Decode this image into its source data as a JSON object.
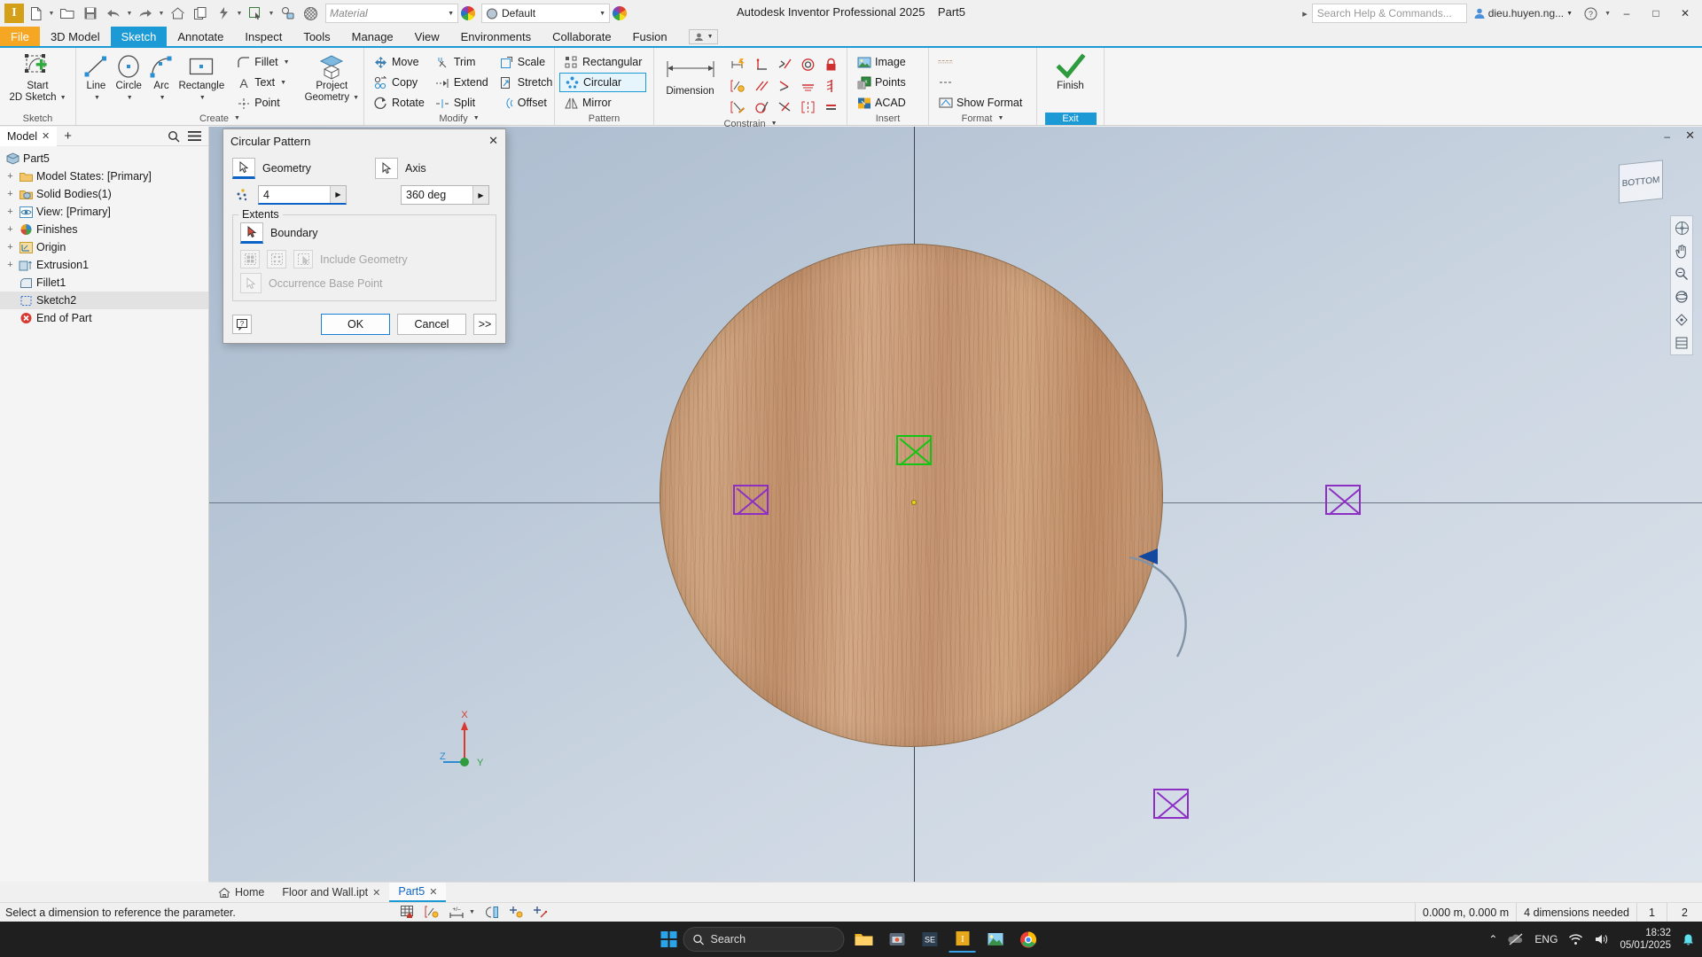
{
  "window": {
    "app_title": "Autodesk Inventor Professional 2025",
    "document_title": "Part5",
    "minimize": "–",
    "maximize": "□",
    "close": "✕"
  },
  "qat": {
    "logo": "I",
    "items": [
      {
        "name": "new-file-icon",
        "glyph": "new"
      },
      {
        "name": "open-file-icon",
        "glyph": "open"
      },
      {
        "name": "save-icon",
        "glyph": "save"
      },
      {
        "name": "undo-icon",
        "glyph": "undo"
      },
      {
        "name": "redo-icon",
        "glyph": "redo"
      },
      {
        "name": "home-icon",
        "glyph": "home"
      },
      {
        "name": "copy-icon",
        "glyph": "copy"
      },
      {
        "name": "update-icon",
        "glyph": "update"
      },
      {
        "name": "select-icon",
        "glyph": "select"
      },
      {
        "name": "measure-icon",
        "glyph": "measure"
      },
      {
        "name": "material-sphere-icon",
        "glyph": "sphere"
      }
    ],
    "material_value": "Material",
    "appearance_value": "Default"
  },
  "search": {
    "help_placeholder": "Search Help & Commands..."
  },
  "account": {
    "user": "dieu.huyen.ng...",
    "caret": "▾",
    "help": "?"
  },
  "menu": {
    "tabs": [
      {
        "label": "File",
        "state": "file"
      },
      {
        "label": "3D Model",
        "state": "normal"
      },
      {
        "label": "Sketch",
        "state": "active"
      },
      {
        "label": "Annotate",
        "state": "normal"
      },
      {
        "label": "Inspect",
        "state": "normal"
      },
      {
        "label": "Tools",
        "state": "normal"
      },
      {
        "label": "Manage",
        "state": "normal"
      },
      {
        "label": "View",
        "state": "normal"
      },
      {
        "label": "Environments",
        "state": "normal"
      },
      {
        "label": "Collaborate",
        "state": "normal"
      },
      {
        "label": "Fusion",
        "state": "normal"
      }
    ]
  },
  "ribbon": {
    "panels": [
      {
        "title": "Sketch",
        "big": {
          "line1": "Start",
          "line2": "2D Sketch",
          "icon": "start-2d-sketch-icon"
        }
      },
      {
        "title": "Create",
        "big_items": [
          {
            "label": "Line",
            "icon": "line-icon"
          },
          {
            "label": "Circle",
            "icon": "circle-icon"
          },
          {
            "label": "Arc",
            "icon": "arc-icon"
          },
          {
            "label": "Rectangle",
            "icon": "rectangle-icon"
          }
        ],
        "small_items": [
          {
            "label": "Fillet",
            "icon": "fillet-icon",
            "caret": true
          },
          {
            "label": "Text",
            "icon": "text-icon",
            "caret": true
          },
          {
            "label": "Point",
            "icon": "point-icon",
            "caret": false
          }
        ],
        "project": {
          "line1": "Project",
          "line2": "Geometry",
          "icon": "project-geometry-icon"
        }
      },
      {
        "title": "Modify",
        "columns": [
          [
            {
              "label": "Move",
              "icon": "move-icon"
            },
            {
              "label": "Copy",
              "icon": "copy-icon"
            },
            {
              "label": "Rotate",
              "icon": "rotate-icon"
            }
          ],
          [
            {
              "label": "Trim",
              "icon": "trim-icon"
            },
            {
              "label": "Extend",
              "icon": "extend-icon"
            },
            {
              "label": "Split",
              "icon": "split-icon"
            }
          ],
          [
            {
              "label": "Scale",
              "icon": "scale-icon"
            },
            {
              "label": "Stretch",
              "icon": "stretch-icon"
            },
            {
              "label": "Offset",
              "icon": "offset-icon"
            }
          ]
        ]
      },
      {
        "title": "Pattern",
        "items": [
          {
            "label": "Rectangular",
            "icon": "rectangular-pattern-icon",
            "selected": false
          },
          {
            "label": "Circular",
            "icon": "circular-pattern-icon",
            "selected": true
          },
          {
            "label": "Mirror",
            "icon": "mirror-icon",
            "selected": false
          }
        ]
      },
      {
        "title": "Constrain",
        "dimension_label": "Dimension",
        "constraint_icons": [
          "auto-dimension-icon",
          "perpendicular-constraint-icon",
          "tangent-constraint-icon",
          "concentric-constraint-icon",
          "fix-constraint-icon",
          "show-constraints-icon",
          "parallel-constraint-icon",
          "coincident-constraint-icon",
          "horizontal-constraint-icon",
          "vertical-constraint-icon",
          "auto-constraint-icon",
          "smooth-constraint-icon",
          "collinear-constraint-icon",
          "symmetric-constraint-icon",
          "equal-constraint-icon"
        ]
      },
      {
        "title": "Insert",
        "items": [
          {
            "label": "Image",
            "icon": "image-icon"
          },
          {
            "label": "Points",
            "icon": "points-import-icon"
          },
          {
            "label": "ACAD",
            "icon": "acad-import-icon"
          }
        ]
      },
      {
        "title": "Format",
        "items": [
          {
            "label": "",
            "icon": "linetype-icon"
          },
          {
            "label": "",
            "icon": "construction-icon"
          },
          {
            "label": "Show Format",
            "icon": "show-format-icon"
          }
        ]
      },
      {
        "title": "Exit",
        "finish_label": "Finish",
        "exit_label": "Exit",
        "icon": "finish-sketch-check-icon"
      }
    ]
  },
  "browser": {
    "tab_label": "Model",
    "tab_close": "✕",
    "add": "+",
    "search_icon": "search-icon",
    "menu_icon": "hamburger-menu-icon",
    "tree": [
      {
        "label": "Part5",
        "expander": "",
        "icon": "part-icon",
        "indent": 0,
        "selected": false
      },
      {
        "label": "Model States: [Primary]",
        "expander": "+",
        "icon": "folder-icon",
        "indent": 1,
        "selected": false
      },
      {
        "label": "Solid Bodies(1)",
        "expander": "+",
        "icon": "solid-bodies-icon",
        "indent": 1,
        "selected": false
      },
      {
        "label": "View: [Primary]",
        "expander": "+",
        "icon": "view-icon",
        "indent": 1,
        "selected": false
      },
      {
        "label": "Finishes",
        "expander": "+",
        "icon": "finishes-icon",
        "indent": 1,
        "selected": false
      },
      {
        "label": "Origin",
        "expander": "+",
        "icon": "origin-icon",
        "indent": 1,
        "selected": false
      },
      {
        "label": "Extrusion1",
        "expander": "+",
        "icon": "extrusion-icon",
        "indent": 1,
        "selected": false
      },
      {
        "label": "Fillet1",
        "expander": "",
        "icon": "fillet-feature-icon",
        "indent": 1,
        "selected": false
      },
      {
        "label": "Sketch2",
        "expander": "",
        "icon": "sketch-icon",
        "indent": 1,
        "selected": true
      },
      {
        "label": "End of Part",
        "expander": "",
        "icon": "end-of-part-icon",
        "indent": 1,
        "selected": false
      }
    ]
  },
  "dialog": {
    "title": "Circular Pattern",
    "close": "✕",
    "geometry_label": "Geometry",
    "axis_label": "Axis",
    "count_value": "4",
    "angle_value": "360 deg",
    "spinner": "▶",
    "extents_legend": "Extents",
    "boundary_label": "Boundary",
    "include_geometry_label": "Include Geometry",
    "occurrence_base_point_label": "Occurrence Base Point",
    "help_button": "?",
    "ok_label": "OK",
    "cancel_label": "Cancel",
    "more_label": ">>"
  },
  "canvas": {
    "viewcube_label": "BOTTOM",
    "minimize": "–",
    "close": "✕",
    "triad": {
      "x": "X",
      "y": "Y",
      "z": "Z"
    },
    "nav_icons": [
      "full-navigation-wheel-icon",
      "pan-icon",
      "zoom-icon",
      "orbit-icon",
      "look-at-icon",
      "display-icon"
    ]
  },
  "doc_tabs": [
    {
      "label": "Home",
      "icon": "home-icon",
      "close": "",
      "active": false
    },
    {
      "label": "Floor and Wall.ipt",
      "icon": "",
      "close": "✕",
      "active": false
    },
    {
      "label": "Part5",
      "icon": "",
      "close": "✕",
      "active": true
    }
  ],
  "status": {
    "message": "Select a dimension to reference the parameter.",
    "tool_icons": [
      "grid-snap-icon",
      "show-constraints-status-icon",
      "dimension-display-icon",
      "slice-graphics-icon",
      "constraint-inference-icon",
      "constraint-persistence-icon"
    ],
    "coordinates": "0.000 m, 0.000 m",
    "dimensions_needed": "4 dimensions needed",
    "cell_1": "1",
    "cell_2": "2"
  },
  "taskbar": {
    "search_placeholder": "Search",
    "apps": [
      {
        "name": "file-explorer-icon",
        "active": false
      },
      {
        "name": "store-icon",
        "active": false
      },
      {
        "name": "se-app-icon",
        "active": false
      },
      {
        "name": "inventor-app-icon",
        "active": true
      },
      {
        "name": "photos-icon",
        "active": false
      },
      {
        "name": "chrome-icon",
        "active": false
      }
    ],
    "tray": {
      "chevron": "⌃",
      "language": "ENG",
      "time": "18:32",
      "date": "05/01/2025"
    }
  },
  "colors": {
    "accent_blue": "#1b9ad6",
    "file_orange": "#f5a623",
    "selected_green": "#14c414",
    "pattern_purple": "#8e2fc4",
    "wood": "#c79a76"
  }
}
